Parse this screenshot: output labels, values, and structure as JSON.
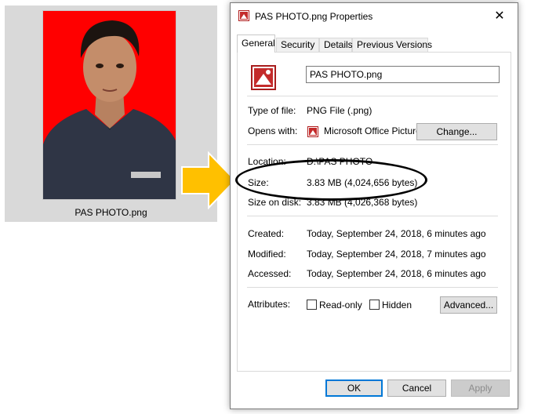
{
  "file_caption": "PAS PHOTO.png",
  "dialog": {
    "title": "PAS PHOTO.png Properties",
    "close_glyph": "✕",
    "tabs": [
      "General",
      "Security",
      "Details",
      "Previous Versions"
    ],
    "active_tab": "General",
    "file_name": "PAS PHOTO.png",
    "fields": {
      "type_label": "Type of file:",
      "type_value": "PNG File (.png)",
      "opens_label": "Opens with:",
      "opens_value": "Microsoft Office Picture",
      "change_label": "Change...",
      "location_label": "Location:",
      "location_value": "D:\\PAS PHOTO",
      "size_label": "Size:",
      "size_value": "3.83 MB (4,024,656 bytes)",
      "size_disk_label": "Size on disk:",
      "size_disk_value": "3.83 MB (4,026,368 bytes)",
      "created_label": "Created:",
      "created_value": "Today, September 24, 2018, 6 minutes ago",
      "modified_label": "Modified:",
      "modified_value": "Today, September 24, 2018, 7 minutes ago",
      "accessed_label": "Accessed:",
      "accessed_value": "Today, September 24, 2018, 6 minutes ago",
      "attributes_label": "Attributes:",
      "readonly_label": "Read-only",
      "hidden_label": "Hidden",
      "advanced_label": "Advanced..."
    },
    "buttons": {
      "ok": "OK",
      "cancel": "Cancel",
      "apply": "Apply"
    }
  },
  "colors": {
    "photo_background": "#ff0000",
    "arrow": "#ffc000",
    "accent": "#0078d7"
  },
  "icons": [
    "picture-file-icon",
    "close-icon",
    "arrow-right-icon"
  ]
}
